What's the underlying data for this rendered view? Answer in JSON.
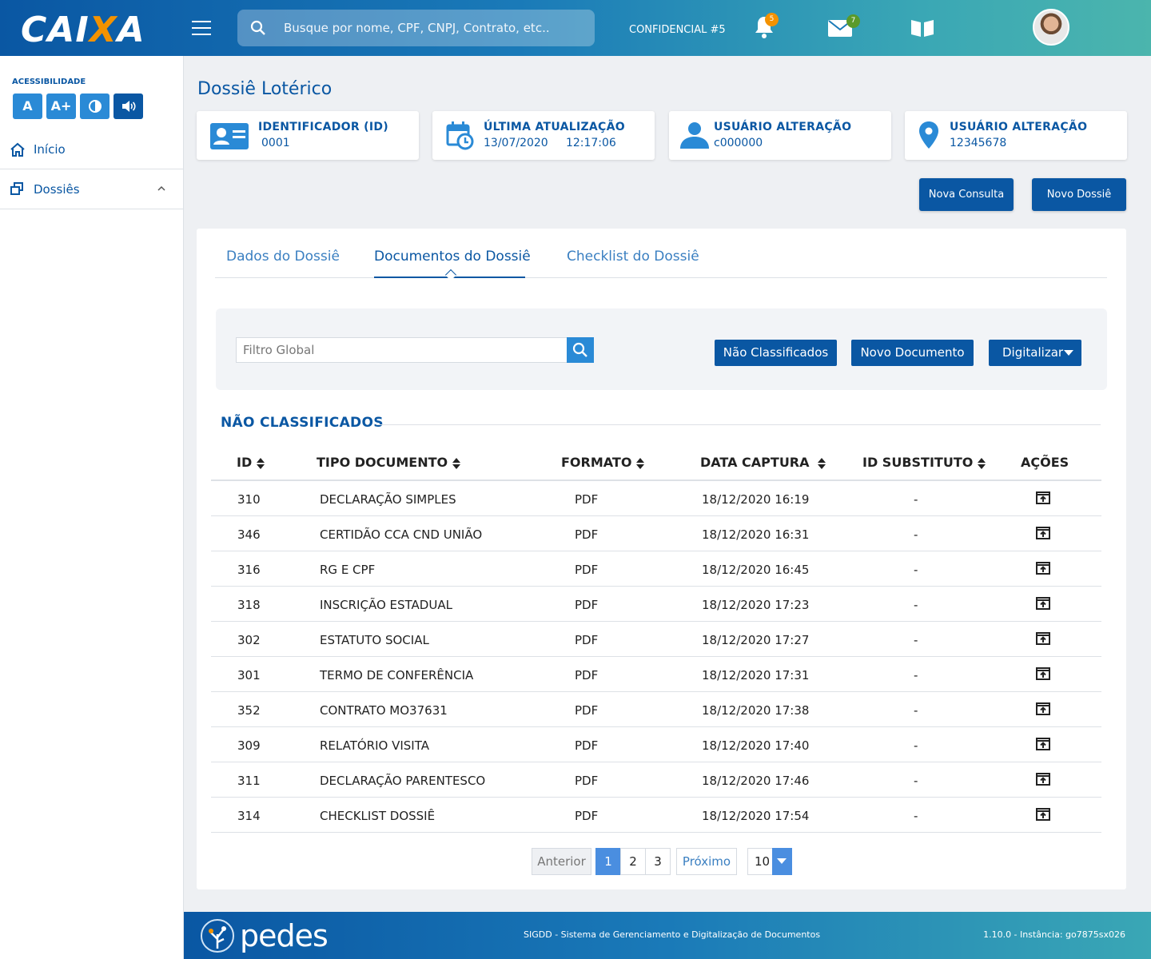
{
  "brand": {
    "logo_main": "CAI",
    "logo_x": "X",
    "logo_end": "A"
  },
  "header": {
    "search_placeholder": "Busque por nome, CPF, CNPJ, Contrato, etc..",
    "confidential": "CONFIDENCIAL #5",
    "notifications_count": "5",
    "messages_count": "7",
    "notif_badge_color": "#f39200",
    "msg_badge_color": "#5a9a2a"
  },
  "sidebar": {
    "accessibility_label": "ACESSIBILIDADE",
    "acc_buttons": [
      "A",
      "A+"
    ],
    "items": [
      {
        "label": "Início"
      },
      {
        "label": "Dossiês"
      }
    ]
  },
  "page": {
    "title": "Dossiê Lotérico",
    "cards": [
      {
        "title": "IDENTIFICADOR (ID)",
        "value": "0001"
      },
      {
        "title": "ÚLTIMA ATUALIZAÇÃO",
        "value": "13/07/2020     12:17:06"
      },
      {
        "title": "USUÁRIO ALTERAÇÃO",
        "value": "c000000"
      },
      {
        "title": "USUÁRIO ALTERAÇÃO",
        "value": "12345678"
      }
    ],
    "actions": {
      "new_query": "Nova Consulta",
      "new_dossier": "Novo Dossiê"
    }
  },
  "tabs": [
    "Dados do Dossiê",
    "Documentos do Dossiê",
    "Checklist do Dossiê"
  ],
  "filter": {
    "placeholder": "Filtro Global",
    "btn_unclassified": "Não Classificados",
    "btn_new_document": "Novo Documento",
    "btn_scan": "Digitalizar"
  },
  "section_title": "NÃO CLASSIFICADOS",
  "table": {
    "headers": [
      "ID",
      "TIPO DOCUMENTO",
      "FORMATO",
      "DATA CAPTURA",
      "ID SUBSTITUTO",
      "AÇÕES"
    ],
    "rows": [
      [
        "310",
        "DECLARAÇÃO SIMPLES",
        "PDF",
        "18/12/2020 16:19",
        "-"
      ],
      [
        "346",
        "CERTIDÃO CCA CND UNIÃO",
        "PDF",
        "18/12/2020 16:31",
        "-"
      ],
      [
        "316",
        "RG E CPF",
        "PDF",
        "18/12/2020 16:45",
        "-"
      ],
      [
        "318",
        "INSCRIÇÃO ESTADUAL",
        "PDF",
        "18/12/2020 17:23",
        "-"
      ],
      [
        "302",
        "ESTATUTO SOCIAL",
        "PDF",
        "18/12/2020 17:27",
        "-"
      ],
      [
        "301",
        "TERMO DE CONFERÊNCIA",
        "PDF",
        "18/12/2020 17:31",
        "-"
      ],
      [
        "352",
        "CONTRATO MO37631",
        "PDF",
        "18/12/2020 17:38",
        "-"
      ],
      [
        "309",
        "RELATÓRIO VISITA",
        "PDF",
        "18/12/2020 17:40",
        "-"
      ],
      [
        "311",
        "DECLARAÇÃO PARENTESCO",
        "PDF",
        "18/12/2020 17:46",
        "-"
      ],
      [
        "314",
        "CHECKLIST DOSSIÊ",
        "PDF",
        "18/12/2020 17:54",
        "-"
      ]
    ]
  },
  "pagination": {
    "prev": "Anterior",
    "pages": [
      "1",
      "2",
      "3"
    ],
    "current": "1",
    "next": "Próximo",
    "page_size": "10"
  },
  "footer": {
    "brand": "pedes",
    "system": "SIGDD - Sistema de Gerenciamento e Digitalização de Documentos",
    "version": "1.10.0 - Instância: go7875sx026"
  }
}
